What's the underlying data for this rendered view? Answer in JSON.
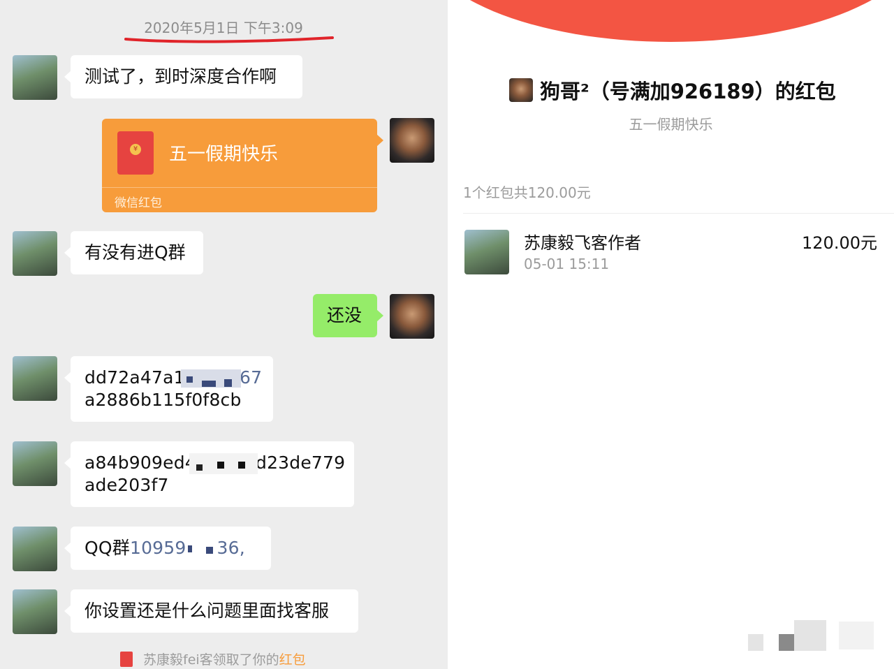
{
  "chat": {
    "timestamp": "2020年5月1日 下午3:09",
    "messages": [
      {
        "text": "测试了，到时深度合作啊"
      },
      {
        "text": "有没有进Q群"
      },
      {
        "text": "还没"
      },
      {
        "line1": "dd72a47a1",
        "line1_tail": "67",
        "line2": "a2886b115f0f8cb"
      },
      {
        "line1": "a84b909ed4",
        "line1_tail": "d23de779",
        "line2": "ade203f7"
      },
      {
        "prefix": "QQ群",
        "number_head": "10959",
        "number_tail": "36,"
      },
      {
        "text": "你设置还是什么问题里面找客服"
      }
    ],
    "red_packet": {
      "title": "五一假期快乐",
      "footer": "微信红包",
      "coin": "¥"
    },
    "system_notice": {
      "text": "苏康毅fei客领取了你的",
      "link": "红包"
    }
  },
  "detail": {
    "sender_title": "狗哥²（号满加926189）的红包",
    "greeting": "五一假期快乐",
    "summary": "1个红包共120.00元",
    "receiver": {
      "name": "苏康毅飞客作者",
      "time": "05-01 15:11",
      "amount": "120.00元"
    }
  },
  "colors": {
    "chat_bg": "#ededed",
    "self_bubble": "#95ec69",
    "red_packet": "#f79c3b",
    "header_red": "#f35543",
    "link_orange": "#f79c3b",
    "qq_blue": "#576b95"
  }
}
